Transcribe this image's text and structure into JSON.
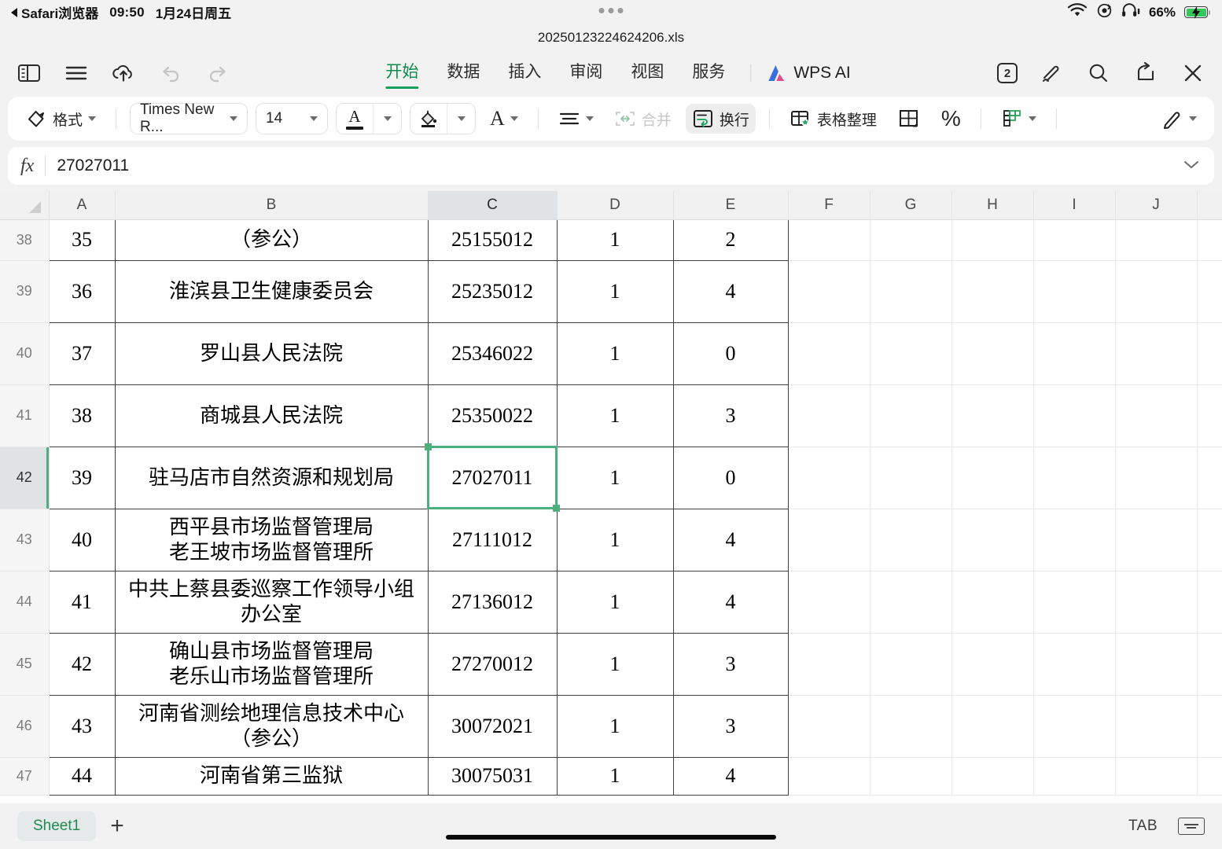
{
  "statusbar": {
    "back_label": "Safari浏览器",
    "time": "09:50",
    "date": "1月24日周五",
    "battery_percent": "66%",
    "icons": [
      "wifi-icon",
      "rotation-lock-icon",
      "headphones-icon",
      "battery-charging-icon"
    ]
  },
  "title": "20250123224624206.xls",
  "ribbon": {
    "left_icons": [
      "sidebar-toggle-icon",
      "menu-icon",
      "cloud-upload-icon",
      "undo-icon",
      "redo-icon"
    ],
    "tabs": [
      {
        "label": "开始",
        "active": true
      },
      {
        "label": "数据",
        "active": false
      },
      {
        "label": "插入",
        "active": false
      },
      {
        "label": "审阅",
        "active": false
      },
      {
        "label": "视图",
        "active": false
      },
      {
        "label": "服务",
        "active": false
      }
    ],
    "ai_label": "WPS AI",
    "tab_count": "2",
    "right_icons": [
      "tab-count-icon",
      "edit-pen-icon",
      "search-icon",
      "share-icon",
      "close-icon"
    ],
    "accent_color": "#17a05b"
  },
  "format_toolbar": {
    "format_label": "格式",
    "font_name": "Times New R...",
    "font_size": "14",
    "merge_label": "合并",
    "wrap_label": "换行",
    "table_tidy_label": "表格整理",
    "percent_label": "%",
    "buttons": [
      "format-brush-button",
      "font-name-select",
      "font-size-select",
      "font-color-button",
      "fill-color-button",
      "font-style-button",
      "align-button",
      "merge-button",
      "wrap-text-button",
      "table-tidy-button",
      "borders-button",
      "percent-button",
      "conditional-format-button",
      "pen-button"
    ]
  },
  "formula_bar": {
    "fx_label": "fx",
    "value": "27027011"
  },
  "grid": {
    "columns": [
      "A",
      "B",
      "C",
      "D",
      "E",
      "F",
      "G",
      "H",
      "I",
      "J"
    ],
    "selected_column": "C",
    "selected_row": "42",
    "selected_cell": "C42",
    "selection_color": "#4caf7d",
    "rows": [
      {
        "head": "38",
        "partial": "top",
        "a": "35",
        "b": "（参公）",
        "c": "25155012",
        "d": "1",
        "e": "2"
      },
      {
        "head": "39",
        "a": "36",
        "b": "淮滨县卫生健康委员会",
        "c": "25235012",
        "d": "1",
        "e": "4"
      },
      {
        "head": "40",
        "a": "37",
        "b": "罗山县人民法院",
        "c": "25346022",
        "d": "1",
        "e": "0"
      },
      {
        "head": "41",
        "a": "38",
        "b": "商城县人民法院",
        "c": "25350022",
        "d": "1",
        "e": "3"
      },
      {
        "head": "42",
        "selected": true,
        "a": "39",
        "b": "驻马店市自然资源和规划局",
        "c": "27027011",
        "d": "1",
        "e": "0"
      },
      {
        "head": "43",
        "a": "40",
        "b": "西平县市场监督管理局",
        "b2": "老王坡市场监督管理所",
        "c": "27111012",
        "d": "1",
        "e": "4"
      },
      {
        "head": "44",
        "a": "41",
        "b": "中共上蔡县委巡察工作领导小组",
        "b2": "办公室",
        "c": "27136012",
        "d": "1",
        "e": "4"
      },
      {
        "head": "45",
        "a": "42",
        "b": "确山县市场监督管理局",
        "b2": "老乐山市场监督管理所",
        "c": "27270012",
        "d": "1",
        "e": "3"
      },
      {
        "head": "46",
        "a": "43",
        "b": "河南省测绘地理信息技术中心",
        "b2": "（参公）",
        "c": "30072021",
        "d": "1",
        "e": "3"
      },
      {
        "head": "47",
        "partial": "bottom",
        "a": "44",
        "b": "河南省第三监狱",
        "c": "30075031",
        "d": "1",
        "e": "4"
      }
    ]
  },
  "bottom_bar": {
    "sheet_name": "Sheet1",
    "add_sheet_label": "+",
    "tab_key_label": "TAB",
    "keyboard_icon": "keyboard-icon"
  }
}
